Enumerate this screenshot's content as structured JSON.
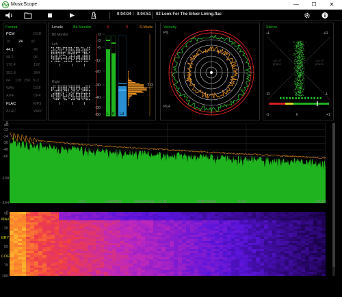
{
  "window": {
    "title": "MusicScope",
    "controls": {
      "minimize": "—",
      "maximize": "☐",
      "close": "✕"
    }
  },
  "toolbar": {
    "icons": [
      "volume-icon",
      "folder-icon",
      "stop-icon",
      "play-icon",
      "metronome-icon",
      "gear-icon",
      "info-icon"
    ],
    "position": "0:04:04",
    "separator": "/",
    "duration": "0:04:51",
    "track": "02 Look For The Silver Lining.flac"
  },
  "format": {
    "title": "Format",
    "rows": [
      {
        "l": "PCM",
        "r": "DSD",
        "lc": "#ffffff",
        "rc": "#555555"
      },
      {
        "cells": [
          "16",
          "24",
          "32"
        ],
        "hi": 1
      },
      {
        "l": "44.1",
        "r": "48",
        "lc": "#ffffff",
        "rc": "#555555"
      },
      {
        "l": "88.2",
        "r": "96",
        "lc": "#555555",
        "rc": "#555555"
      },
      {
        "l": "176.4",
        "r": "192",
        "lc": "#555555",
        "rc": "#555555"
      },
      {
        "l": "352.8",
        "r": "384",
        "lc": "#555555",
        "rc": "#555555"
      },
      {
        "cells": [
          "64",
          "128",
          "256",
          "512"
        ],
        "hi": -1
      },
      {
        "l": "WAV",
        "r": "DSF",
        "lc": "#555555",
        "rc": "#555555"
      },
      {
        "l": "AIFF",
        "r": "DFF",
        "lc": "#555555",
        "rc": "#555555"
      },
      {
        "l": "FLAC",
        "r": "MP3",
        "lc": "#ffffff",
        "rc": "#555555"
      },
      {
        "l": "ALAC",
        "r": "WAV",
        "lc": "#555555",
        "rc": "#555555"
      }
    ]
  },
  "levels": {
    "title": "Levels",
    "bit_monitor": "Bit Monitor",
    "bit_monitor_sub": "Bit Monitor",
    "left": "Left",
    "right": "Right",
    "s_mode": "S-Mode",
    "scale": [
      "0",
      "-3",
      "-6",
      "-12",
      "-20",
      "-30",
      "-40",
      "-50",
      "-60"
    ],
    "l_label": "L",
    "r_label": "R",
    "peak_left": "0",
    "peak_right": "0",
    "lu_label": "LU",
    "reading": "7.0"
  },
  "velocity": {
    "title": "Velocity",
    "pil": "PIL",
    "plr": "PLR"
  },
  "stereo": {
    "title": "Stereo",
    "plus_l": "+L",
    "plus_r": "+R",
    "minus_l": "-R",
    "minus_r": "-L",
    "out_of_phase_l": "out of phase",
    "out_of_phase_r": "out of phase",
    "corr_min": "-1",
    "corr_mid": "0",
    "corr_max": "+1"
  },
  "spectrum": {
    "db_label": "dB",
    "y_ticks": [
      "0",
      "-12",
      "-24",
      "-36",
      "-48",
      "-60",
      "-100",
      "-144"
    ],
    "x_label": "Linear Frequency Spectrum (kHz)",
    "x_ticks": [
      "5.51",
      "11.03",
      "16.54",
      "22.05"
    ],
    "mode_labels": [
      "Left/Right",
      "Peak/Phase",
      "-20dB Mode"
    ]
  },
  "sonogram": {
    "pct_label": "%",
    "y_labels": [
      "0",
      "MAX",
      "25",
      "BRY",
      "50",
      "COF",
      "75",
      "100"
    ]
  }
}
